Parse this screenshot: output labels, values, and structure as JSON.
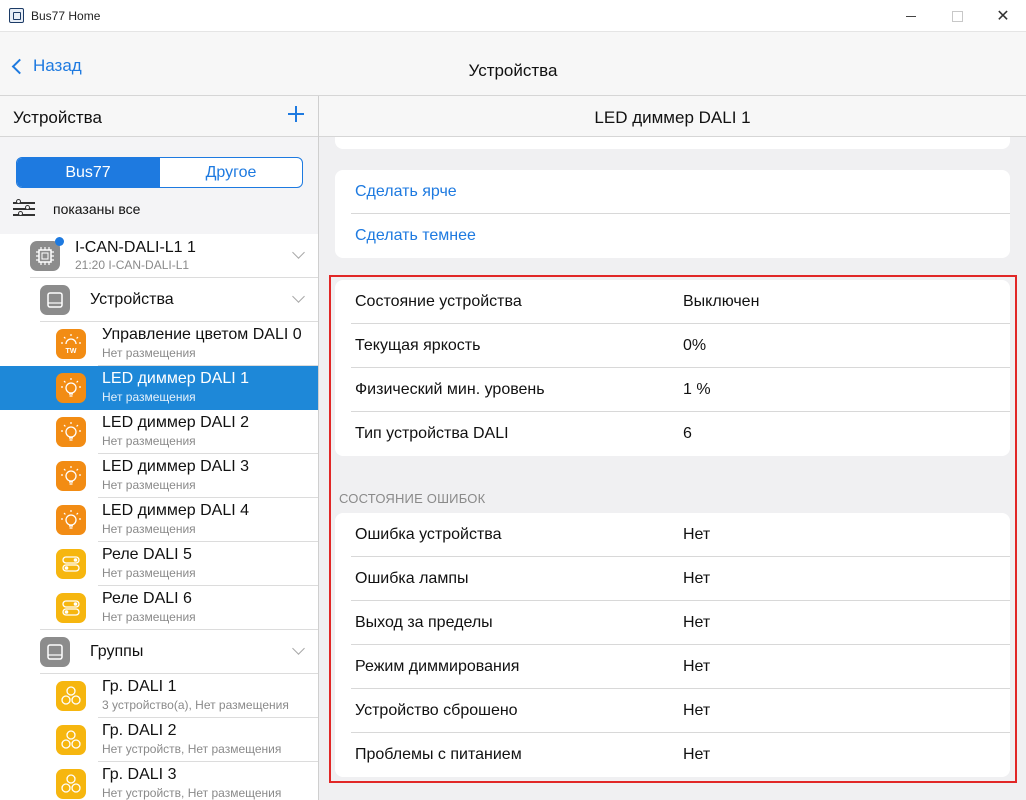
{
  "window": {
    "title": "Bus77 Home",
    "close_glyph": "✕"
  },
  "nav": {
    "back_label": "Назад",
    "title": "Устройства"
  },
  "sidebar": {
    "header": "Устройства",
    "segments": [
      "Bus77",
      "Другое"
    ],
    "filter_label": "показаны все",
    "gateway": {
      "name": "I-CAN-DALI-L1 1",
      "sub": "21:20 I-CAN-DALI-L1"
    },
    "devices_group": "Устройства",
    "devices": [
      {
        "name": "Управление цветом DALI 0",
        "sub": "Нет размещения",
        "icon": "tw-bulb-icon",
        "tw": "TW"
      },
      {
        "name": "LED диммер DALI 1",
        "sub": "Нет размещения",
        "icon": "bulb-icon"
      },
      {
        "name": "LED диммер DALI 2",
        "sub": "Нет размещения",
        "icon": "bulb-icon"
      },
      {
        "name": "LED диммер DALI 3",
        "sub": "Нет размещения",
        "icon": "bulb-icon"
      },
      {
        "name": "LED диммер DALI 4",
        "sub": "Нет размещения",
        "icon": "bulb-icon"
      },
      {
        "name": "Реле DALI 5",
        "sub": "Нет размещения",
        "icon": "relay-toggle-icon"
      },
      {
        "name": "Реле DALI 6",
        "sub": "Нет размещения",
        "icon": "relay-toggle-icon"
      }
    ],
    "groups_group": "Группы",
    "groups": [
      {
        "name": "Гр. DALI 1",
        "sub": "3 устройство(а), Нет размещения"
      },
      {
        "name": "Гр. DALI 2",
        "sub": "Нет устройств, Нет размещения"
      },
      {
        "name": "Гр. DALI 3",
        "sub": "Нет устройств, Нет размещения"
      }
    ]
  },
  "detail": {
    "title": "LED диммер DALI 1",
    "actions": [
      "Сделать ярче",
      "Сделать темнее"
    ],
    "status": [
      {
        "k": "Состояние устройства",
        "v": "Выключен"
      },
      {
        "k": "Текущая яркость",
        "v": "0%"
      },
      {
        "k": "Физический мин. уровень",
        "v": "1 %"
      },
      {
        "k": "Тип устройства DALI",
        "v": "6"
      }
    ],
    "errors_header": "СОСТОЯНИЕ ОШИБОК",
    "errors": [
      {
        "k": "Ошибка устройства",
        "v": "Нет"
      },
      {
        "k": "Ошибка лампы",
        "v": "Нет"
      },
      {
        "k": "Выход за пределы",
        "v": "Нет"
      },
      {
        "k": "Режим диммирования",
        "v": "Нет"
      },
      {
        "k": "Устройство сброшено",
        "v": "Нет"
      },
      {
        "k": "Проблемы с питанием",
        "v": "Нет"
      }
    ]
  },
  "colors": {
    "accent": "#1e7ae0",
    "selected": "#1e88d8",
    "orange": "#f28c14",
    "yellow": "#f6b60f",
    "highlight": "#e12727"
  }
}
